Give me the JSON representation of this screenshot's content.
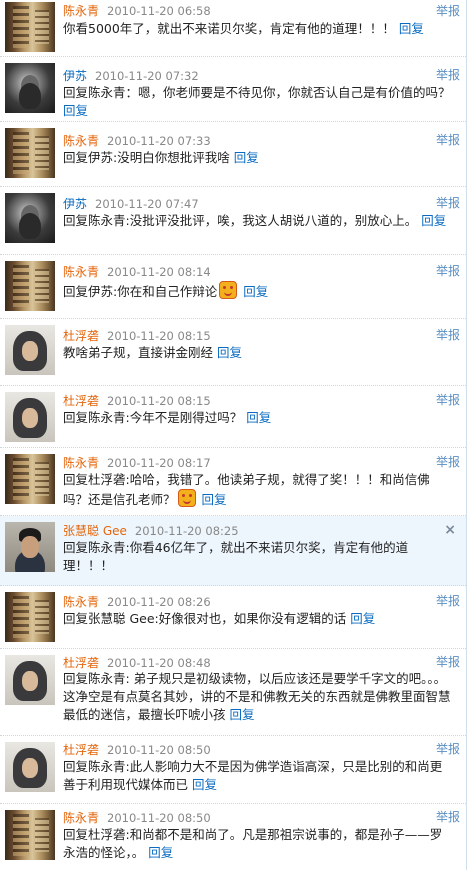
{
  "report_label": "举报",
  "reply_label": "回复",
  "comments": [
    {
      "name": "陈永青",
      "time": "2010-11-20 06:58",
      "text": "你看5000年了，就出不来诺贝尔奖，肯定有他的道理！！！",
      "avatar": "book-cover-avatar"
    },
    {
      "name": "伊苏",
      "time": "2010-11-20 07:32",
      "text": "回复陈永青：嗯，你老师要是不待见你，你就否认自己是有价值的吗？",
      "avatar": "bw-portrait-avatar"
    },
    {
      "name": "陈永青",
      "time": "2010-11-20 07:33",
      "text": "回复伊苏:没明白你想批评我啥",
      "avatar": "book-cover-avatar"
    },
    {
      "name": "伊苏",
      "time": "2010-11-20 07:47",
      "text": "回复陈永青:没批评没批评，唉，我这人胡说八道的，别放心上。",
      "avatar": "bw-portrait-avatar"
    },
    {
      "name": "陈永青",
      "time": "2010-11-20 08:14",
      "text": "回复伊苏:你在和自己作辩论",
      "avatar": "book-cover-avatar",
      "emoji": true
    },
    {
      "name": "杜浮砻",
      "time": "2010-11-20 08:15",
      "text": "教啥弟子规，直接讲金刚经",
      "avatar": "hooded-person-avatar"
    },
    {
      "name": "杜浮砻",
      "time": "2010-11-20 08:15",
      "text": "回复陈永青:今年不是刚得过吗？",
      "avatar": "hooded-person-avatar"
    },
    {
      "name": "陈永青",
      "time": "2010-11-20 08:17",
      "text": "回复杜浮砻:哈哈，我错了。他读弟子规，就得了奖！！！和尚信佛吗？还是信孔老师？",
      "avatar": "book-cover-avatar",
      "emoji": true
    },
    {
      "name": "张慧聪 Gee",
      "time": "2010-11-20 08:25",
      "text": "回复陈永青:你看46亿年了，就出不来诺贝尔奖，肯定有他的道理！！！",
      "avatar": "man-portrait-avatar"
    },
    {
      "name": "陈永青",
      "time": "2010-11-20 08:26",
      "text": "回复张慧聪 Gee:好像很对也，如果你没有逻辑的话",
      "avatar": "book-cover-avatar"
    },
    {
      "name": "杜浮砻",
      "time": "2010-11-20 08:48",
      "text": "回复陈永青: 弟子规只是初级读物，以后应该还是要学千字文的吧。。。这净空是有点莫名其妙，讲的不是和佛教无关的东西就是佛教里面智慧最低的迷信，最擅长吓唬小孩",
      "avatar": "hooded-person-avatar"
    },
    {
      "name": "杜浮砻",
      "time": "2010-11-20 08:50",
      "text": "回复陈永青:此人影响力大不是因为佛学造诣高深，只是比别的和尚更善于利用现代媒体而已",
      "avatar": "hooded-person-avatar"
    },
    {
      "name": "陈永青",
      "time": "2010-11-20 08:50",
      "text": "回复杜浮砻:和尚都不是和尚了。凡是那祖宗说事的，都是孙子——罗永浩的怪论，。",
      "avatar": "book-cover-avatar"
    }
  ],
  "close_symbol": "×"
}
